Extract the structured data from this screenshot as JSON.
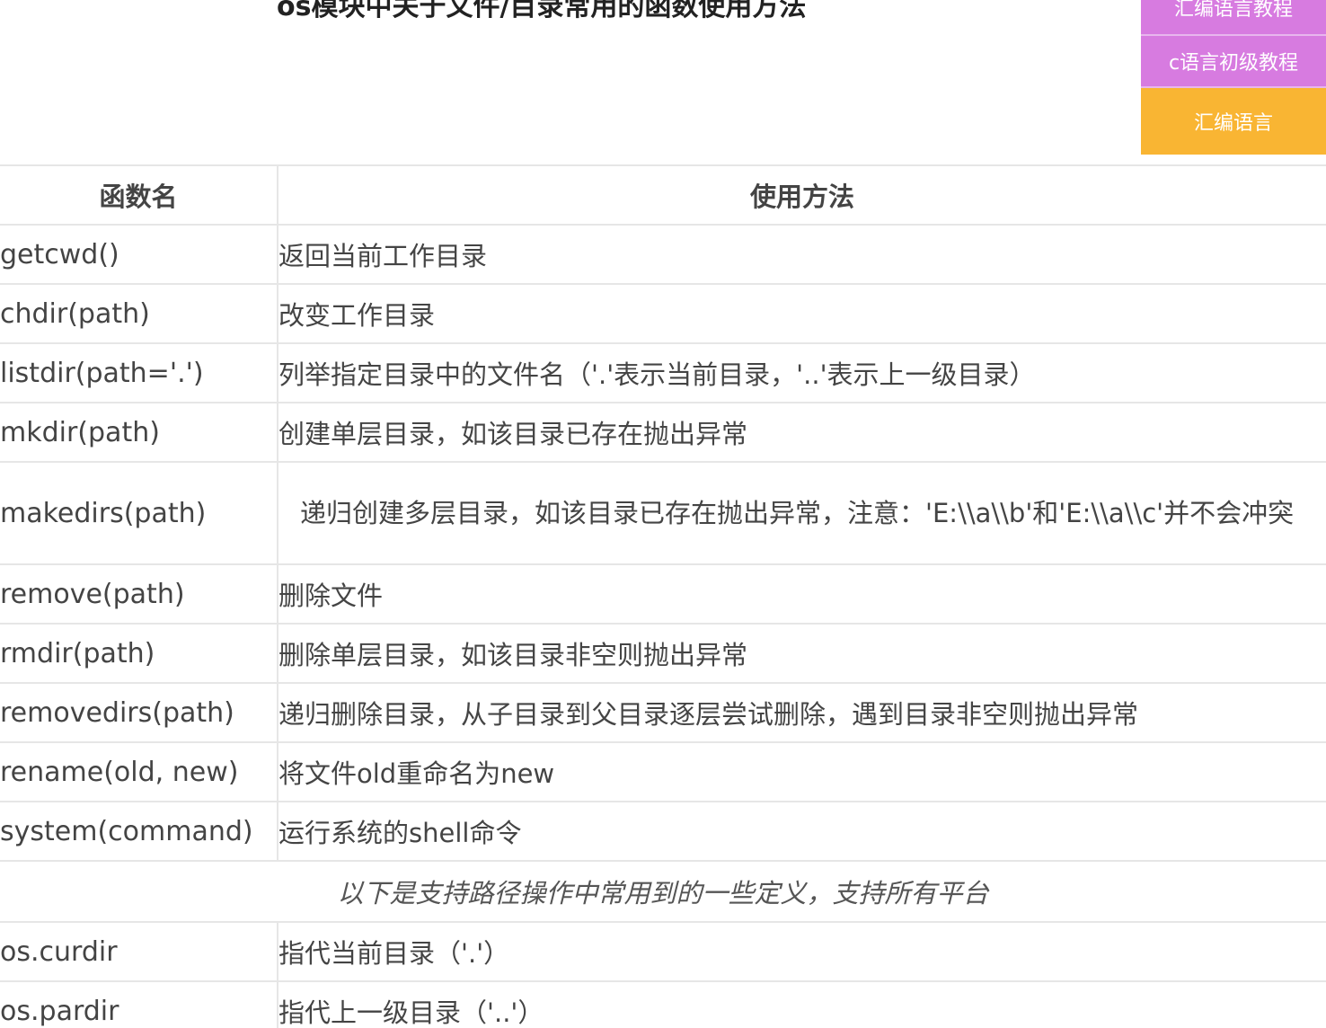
{
  "page": {
    "title": "os模块中关于文件/目录常用的函数使用方法"
  },
  "side_menu": {
    "items": [
      {
        "label": "汇编语言教程",
        "color": "#d77be0"
      },
      {
        "label": "c语言初级教程",
        "color": "#d77be0"
      },
      {
        "label": "汇编语言",
        "color": "#f9b533"
      }
    ]
  },
  "table": {
    "headers": [
      "函数名",
      "使用方法"
    ],
    "rows": [
      {
        "fn": "getcwd()",
        "desc": "返回当前工作目录"
      },
      {
        "fn": "chdir(path)",
        "desc": "改变工作目录"
      },
      {
        "fn": "listdir(path='.')",
        "desc": "列举指定目录中的文件名（'.'表示当前目录，'..'表示上一级目录）"
      },
      {
        "fn": "mkdir(path)",
        "desc": "创建单层目录，如该目录已存在抛出异常"
      },
      {
        "fn": "makedirs(path)",
        "desc": "递归创建多层目录，如该目录已存在抛出异常，注意：'E:\\\\a\\\\b'和'E:\\\\a\\\\c'并不会冲突"
      },
      {
        "fn": "remove(path)",
        "desc": "删除文件"
      },
      {
        "fn": "rmdir(path)",
        "desc": "删除单层目录，如该目录非空则抛出异常"
      },
      {
        "fn": "removedirs(path)",
        "desc": "递归删除目录，从子目录到父目录逐层尝试删除，遇到目录非空则抛出异常"
      },
      {
        "fn": "rename(old, new)",
        "desc": "将文件old重命名为new"
      },
      {
        "fn": "system(command)",
        "desc": "运行系统的shell命令"
      }
    ],
    "note": "以下是支持路径操作中常用到的一些定义，支持所有平台",
    "rows2": [
      {
        "fn": "os.curdir",
        "desc": "指代当前目录（'.'）"
      },
      {
        "fn": "os.pardir",
        "desc": "指代上一级目录（'..'）"
      }
    ]
  }
}
